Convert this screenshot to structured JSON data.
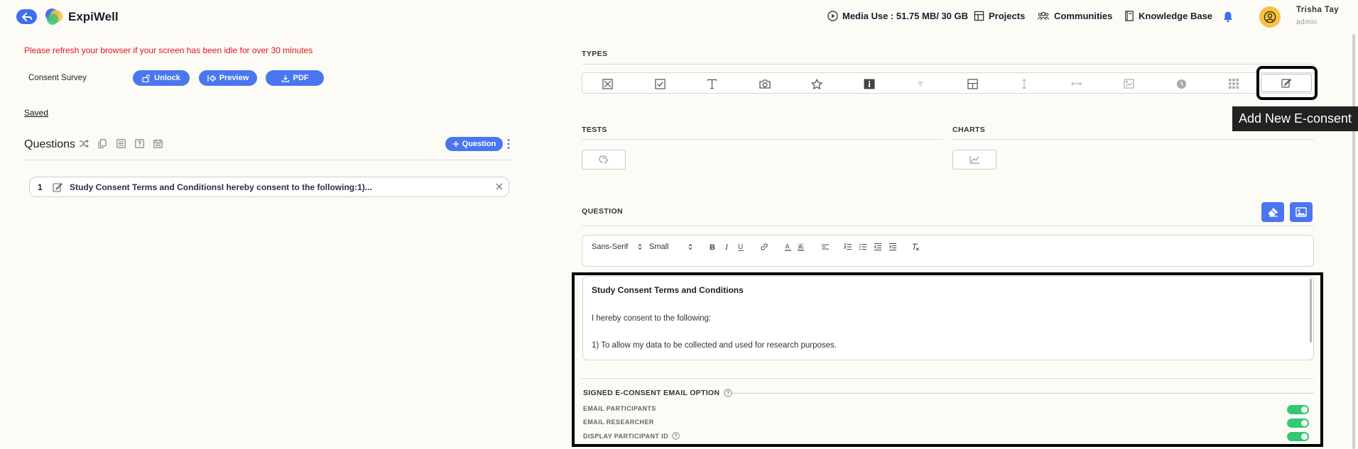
{
  "header": {
    "brand": "ExpiWell",
    "media_use": "Media Use : 51.75 MB/ 30 GB",
    "nav": {
      "projects": "Projects",
      "communities": "Communities",
      "knowledge_base": "Knowledge Base"
    },
    "user": {
      "name": "Trisha Tay",
      "role": "admin"
    },
    "colors": {
      "accent": "#4a77ef",
      "avatar": "#f5c242"
    }
  },
  "left": {
    "refresh_warning": "Please refresh your browser if your screen has been idle for over 30 minutes",
    "survey_name": "Consent Survey",
    "buttons": {
      "unlock": "Unlock",
      "preview": "Preview",
      "pdf": "PDF"
    },
    "saved": "Saved",
    "questions_title": "Questions",
    "add_question": "Question",
    "questions": [
      {
        "number": "1",
        "text": "Study Consent Terms and ConditionsI hereby consent to the following:1)..."
      }
    ]
  },
  "right": {
    "types_label": "TYPES",
    "tests_label": "TESTS",
    "charts_label": "CHARTS",
    "question_label": "QUESTION",
    "tooltip": "Add New E-consent",
    "toolbar": {
      "font": "Sans-Serif",
      "size": "Small"
    },
    "editor": {
      "title": "Study Consent Terms and Conditions",
      "line1": "I hereby consent to the following:",
      "line2": "1) To allow my data to be collected and used for research purposes."
    },
    "signed_title": "SIGNED E-CONSENT EMAIL OPTION",
    "options": [
      {
        "label": "EMAIL PARTICIPANTS",
        "enabled": true
      },
      {
        "label": "EMAIL RESEARCHER",
        "enabled": true
      },
      {
        "label": "DISPLAY PARTICIPANT ID",
        "enabled": true
      }
    ],
    "type_icons": [
      "multiple-choice-icon",
      "checkbox-icon",
      "text-icon",
      "camera-icon",
      "star-rating-icon",
      "info-icon",
      "dropdown-icon",
      "grid-icon",
      "vertical-slider-icon",
      "horizontal-slider-icon",
      "image-choice-icon",
      "time-icon",
      "matrix-icon",
      "econsent-icon"
    ]
  }
}
